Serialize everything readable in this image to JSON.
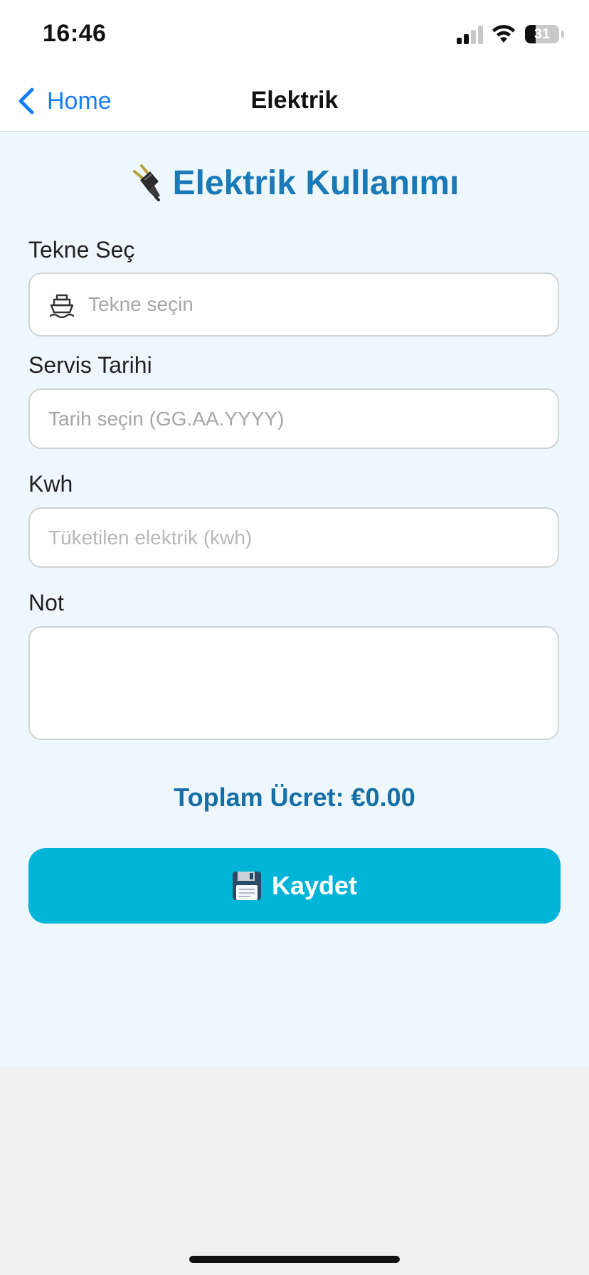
{
  "status_bar": {
    "time": "16:46",
    "battery": "31",
    "battery_level": 0.31,
    "icons": [
      "cellular-signal-icon",
      "wifi-icon",
      "battery-icon"
    ]
  },
  "nav": {
    "back_label": "Home",
    "back_icon": "chevron-left-icon",
    "title": "Elektrik",
    "accent_color": "#147efb"
  },
  "page": {
    "title": "Elektrik Kullanımı",
    "title_icon": "electric-plug-icon",
    "title_color": "#1a7ab8",
    "background": "#eef7fb"
  },
  "form": {
    "boat": {
      "label": "Tekne Seç",
      "placeholder": "Tekne seçin",
      "icon": "ship-icon"
    },
    "date": {
      "label": "Servis Tarihi",
      "placeholder": "Tarih seçin (GG.AA.YYYY)"
    },
    "kwh": {
      "label": "Kwh",
      "placeholder": "Tüketilen elektrik (kwh)"
    },
    "note": {
      "label": "Not",
      "value": ""
    }
  },
  "total": {
    "text": "Toplam Ücret: €0.00"
  },
  "save_button": {
    "label": "Kaydet",
    "icon": "floppy-disk-icon",
    "color": "#02b4d8"
  }
}
